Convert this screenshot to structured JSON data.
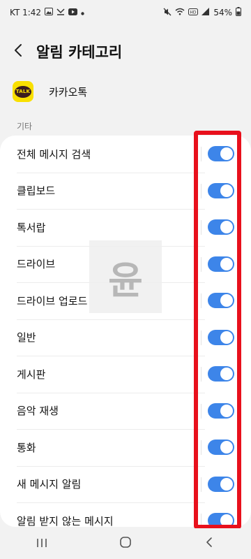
{
  "status_bar": {
    "carrier_time": "KT 1:42",
    "battery": "54%"
  },
  "header": {
    "title": "알림 카테고리",
    "back_icon": "chevron-left-icon"
  },
  "app": {
    "name": "카카오톡",
    "logo_text": "TALK",
    "logo_color": "#f9e000"
  },
  "section_label": "기타",
  "toggle_color": "#3d85e9",
  "highlight_color": "#e8101c",
  "watermark_text": "윤",
  "items": [
    {
      "label": "전체 메시지 검색",
      "enabled": true
    },
    {
      "label": "클립보드",
      "enabled": true
    },
    {
      "label": "톡서랍",
      "enabled": true
    },
    {
      "label": "드라이브",
      "enabled": true
    },
    {
      "label": "드라이브 업로드",
      "enabled": true
    },
    {
      "label": "일반",
      "enabled": true
    },
    {
      "label": "게시판",
      "enabled": true
    },
    {
      "label": "음악 재생",
      "enabled": true
    },
    {
      "label": "통화",
      "enabled": true
    },
    {
      "label": "새 메시지 알림",
      "enabled": true
    },
    {
      "label": "알림 받지 않는 메시지",
      "enabled": true
    }
  ],
  "nav": {
    "recents_icon": "recents-icon",
    "home_icon": "home-icon",
    "back_icon": "back-icon"
  }
}
